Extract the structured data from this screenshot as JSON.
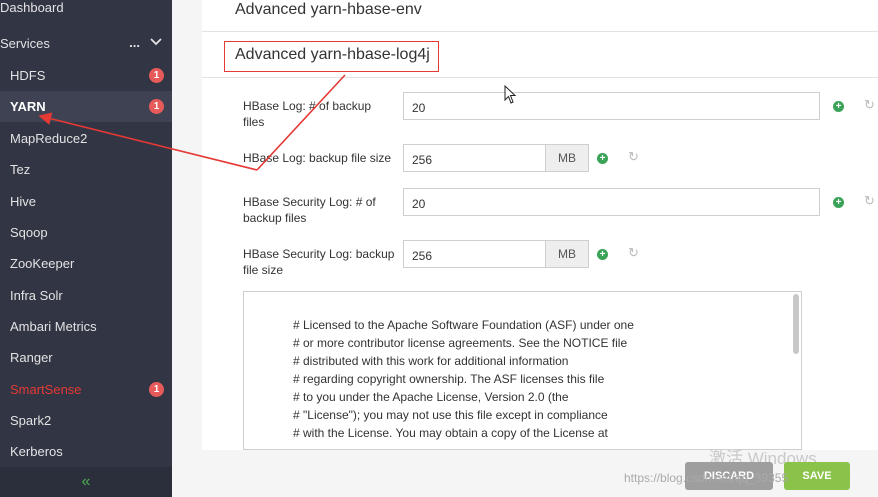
{
  "sidebar": {
    "dashboard": "Dashboard",
    "services_header": "Services",
    "services_more": "...",
    "items": [
      {
        "label": "HDFS",
        "badge": "1"
      },
      {
        "label": "YARN",
        "badge": "1"
      },
      {
        "label": "MapReduce2",
        "badge": ""
      },
      {
        "label": "Tez",
        "badge": ""
      },
      {
        "label": "Hive",
        "badge": ""
      },
      {
        "label": "Sqoop",
        "badge": ""
      },
      {
        "label": "ZooKeeper",
        "badge": ""
      },
      {
        "label": "Infra Solr",
        "badge": ""
      },
      {
        "label": "Ambari Metrics",
        "badge": ""
      },
      {
        "label": "Ranger",
        "badge": ""
      },
      {
        "label": "SmartSense",
        "badge": "1"
      },
      {
        "label": "Spark2",
        "badge": ""
      },
      {
        "label": "Kerberos",
        "badge": ""
      }
    ],
    "collapse": "«"
  },
  "main": {
    "section1_title": "Advanced yarn-hbase-env",
    "section2_title": "Advanced yarn-hbase-log4j",
    "fields": [
      {
        "label": "HBase Log: # of backup files",
        "value": "20",
        "unit": ""
      },
      {
        "label": "HBase Log: backup file size",
        "value": "256",
        "unit": "MB"
      },
      {
        "label": "HBase Security Log: # of backup files",
        "value": "20",
        "unit": ""
      },
      {
        "label": "HBase Security Log: backup file size",
        "value": "256",
        "unit": "MB"
      }
    ],
    "template_lines": [
      "# Licensed to the Apache Software Foundation (ASF) under one",
      "# or more contributor license agreements.  See the NOTICE file",
      "# distributed with this work for additional information",
      "# regarding copyright ownership.  The ASF licenses this file",
      "# to you under the Apache License, Version 2.0 (the",
      "# \"License\"); you may not use this file except in compliance",
      "# with the License.  You may obtain a copy of the License at"
    ]
  },
  "footer": {
    "discard": "DISCARD",
    "save": "SAVE",
    "watermark_activate": "激活 Windows",
    "watermark_url": "https://blog.csdn.net/qq_39355"
  },
  "colors": {
    "sidebar_bg": "#323544",
    "badge": "#e75a5a",
    "annotation": "#e53935",
    "save_green": "#8bc34a"
  }
}
